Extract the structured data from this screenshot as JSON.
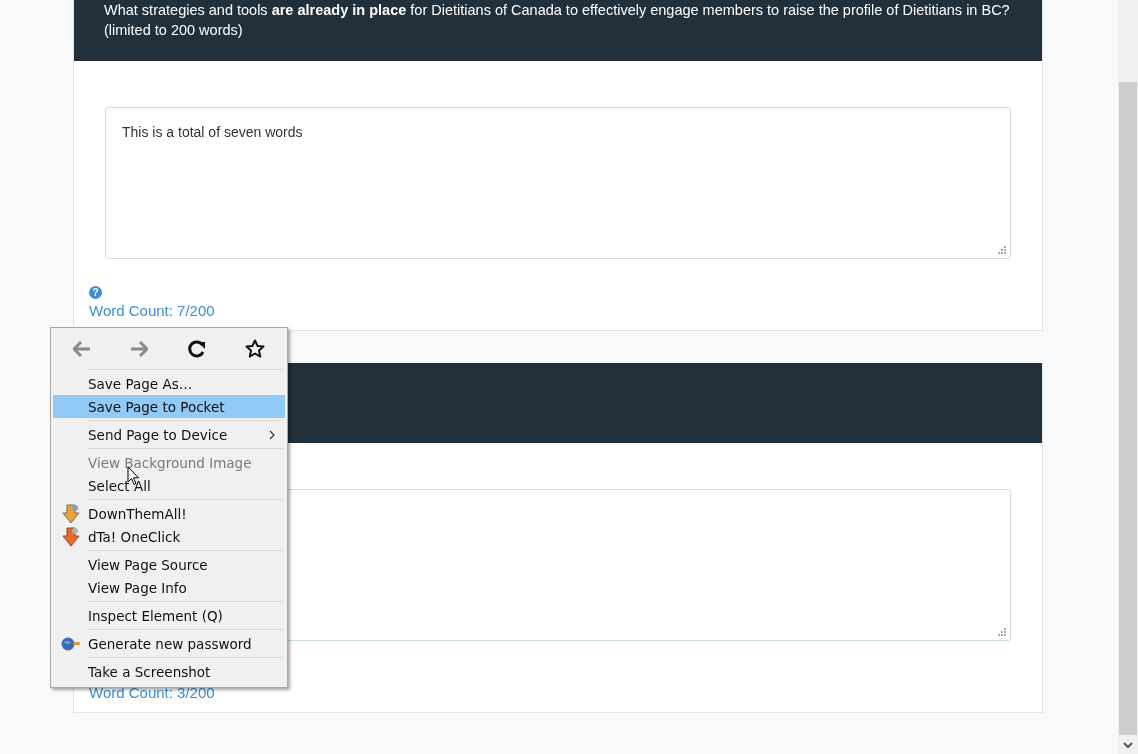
{
  "questions": [
    {
      "prompt": "What strategies and tools **are already in place** for Dietitians of Canada to effectively engage members to raise the profile of Dietitians in BC? (limited to 200 words)",
      "answer": "This is a total of seven words",
      "help": "?",
      "word_count": "Word Count: 7/200"
    },
    {
      "word_count": "Word Count: 3/200"
    }
  ],
  "context_menu": {
    "nav": [
      {
        "kind": "back",
        "disabled": true
      },
      {
        "kind": "forward",
        "disabled": true
      },
      {
        "kind": "reload",
        "disabled": false
      },
      {
        "kind": "bookmark",
        "disabled": false
      }
    ],
    "groups": [
      [
        {
          "label": "Save Page As…",
          "selected": false,
          "disabled": false
        },
        {
          "label": "Save Page to Pocket",
          "selected": true,
          "disabled": false
        }
      ],
      [
        {
          "label": "Send Page to Device",
          "selected": false,
          "disabled": false,
          "submenu": true
        }
      ],
      [
        {
          "label": "View Background Image",
          "selected": false,
          "disabled": true
        },
        {
          "label": "Select All",
          "selected": false,
          "disabled": false
        }
      ],
      [
        {
          "label": "DownThemAll!",
          "selected": false,
          "disabled": false,
          "kind": "download"
        },
        {
          "label": "dTa! OneClick",
          "selected": false,
          "disabled": false,
          "kind": "oneclick"
        }
      ],
      [
        {
          "label": "View Page Source",
          "selected": false,
          "disabled": false
        },
        {
          "label": "View Page Info",
          "selected": false,
          "disabled": false
        }
      ],
      [
        {
          "label": "Inspect Element (Q)",
          "selected": false,
          "disabled": false
        }
      ],
      [
        {
          "label": "Generate new password",
          "selected": false,
          "disabled": false,
          "kind": "password"
        }
      ],
      [
        {
          "label": "Take a Screenshot",
          "selected": false,
          "disabled": false
        }
      ]
    ]
  }
}
